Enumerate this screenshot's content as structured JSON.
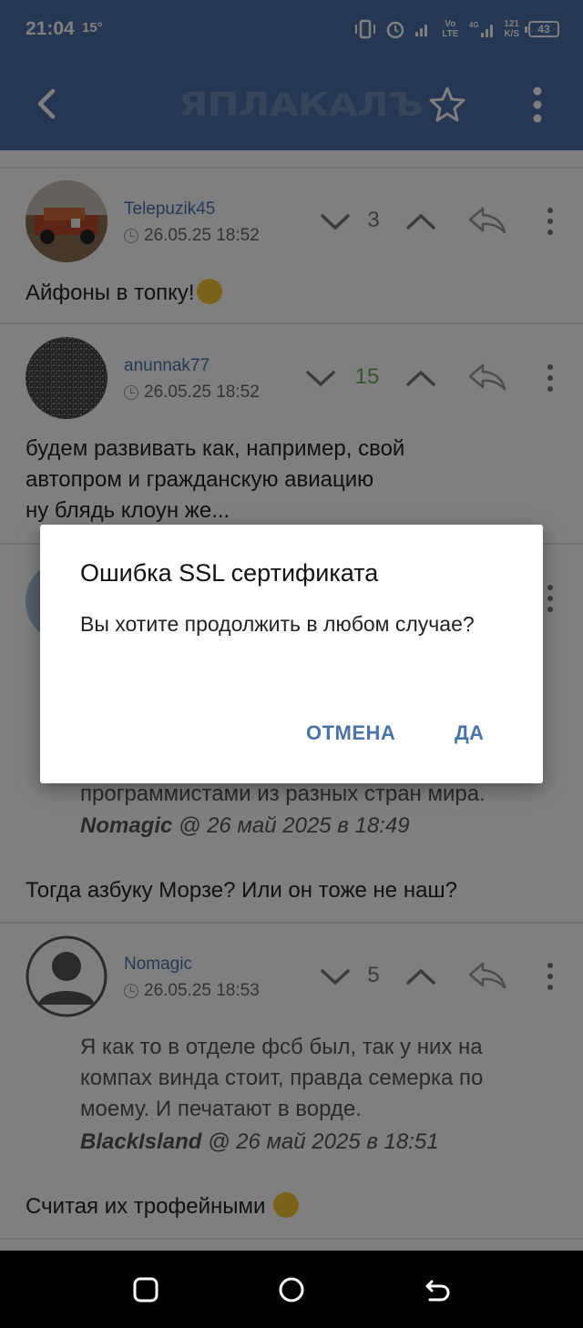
{
  "status": {
    "time": "21:04",
    "temp": "15°",
    "battery": "43",
    "netspeed_value": "121",
    "netspeed_unit": "K/S",
    "network1": "Vo LTE",
    "network2": "4G"
  },
  "header": {
    "logo": "ЯПЛАКАЛЪ"
  },
  "comments": [
    {
      "username": "Telepuzik45",
      "datetime": "26.05.25 18:52",
      "score": "3",
      "text": "Айфоны в топку!"
    },
    {
      "username": "anunnak77",
      "datetime": "26.05.25 18:52",
      "score": "15",
      "text_lines": [
        "будем развивать как, например, свой",
        "автопром и гражданскую авиацию",
        "ну блядь клоун же..."
      ]
    },
    {
      "quote_tail": "программистами из разных стран мира.",
      "quote_author": "Nomagic",
      "quote_date": "@ 26 май 2025 в 18:49",
      "text": "Тогда азбуку Морзе? Или он тоже не наш?"
    },
    {
      "username": "Nomagic",
      "datetime": "26.05.25 18:53",
      "score": "5",
      "quote_lines": [
        "Я как то в отделе фсб был, так у них на",
        "компах винда стоит, правда семерка по",
        "моему. И печатают в ворде."
      ],
      "quote_author": "BlackIsland",
      "quote_date": "@ 26 май 2025 в 18:51",
      "text": "Считая их трофейными"
    }
  ],
  "dialog": {
    "title": "Ошибка SSL сертификата",
    "message": "Вы хотите продолжить в любом случае?",
    "cancel_label": "ОТМЕНА",
    "ok_label": "ДА"
  },
  "colors": {
    "header": "#4a6fa5",
    "link": "#4a73a8",
    "positive_score": "#6fa85c"
  },
  "icons": [
    "back-arrow-icon",
    "star-icon",
    "more-vertical-icon",
    "chevron-down-icon",
    "chevron-up-icon",
    "reply-icon",
    "clock-icon",
    "square-nav-icon",
    "circle-nav-icon",
    "back-nav-icon"
  ]
}
